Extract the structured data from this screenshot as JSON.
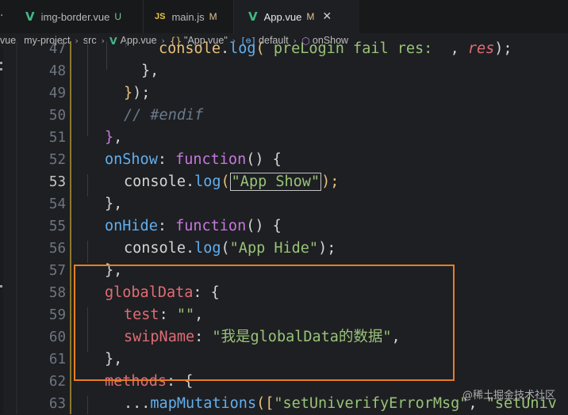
{
  "tabs": [
    {
      "label": "img-border.vue",
      "status": "U",
      "icon": "vue-icon",
      "active": false
    },
    {
      "label": "main.js",
      "status": "M",
      "icon": "js-icon",
      "active": false
    },
    {
      "label": "App.vue",
      "status": "M",
      "icon": "vue-icon",
      "active": true
    }
  ],
  "tab_overflow": "·",
  "close_glyph": "✕",
  "breadcrumb": {
    "cut": "vue",
    "project": "my-project",
    "folder": "src",
    "file": "App.vue",
    "object": "\"App.vue\"",
    "export": "default",
    "method": "onShow"
  },
  "editor": {
    "lines": [
      {
        "number": "47",
        "segments": [
          {
            "t": "    console.log( preLogin fail res:  , res);"
          }
        ]
      },
      {
        "number": "48",
        "segments": [
          {
            "t": "      },"
          }
        ]
      },
      {
        "number": "49",
        "segments": [
          {
            "t": "    });"
          }
        ]
      },
      {
        "number": "50",
        "segments": [
          {
            "t": "    // #endif"
          }
        ]
      },
      {
        "number": "51",
        "segments": [
          {
            "t": "  },"
          }
        ]
      },
      {
        "number": "52",
        "segments": [
          {
            "t": "  onShow: function() {"
          }
        ]
      },
      {
        "number": "53",
        "segments": [
          {
            "t": "    console.log(\"App Show\");"
          }
        ]
      },
      {
        "number": "54",
        "segments": [
          {
            "t": "  },"
          }
        ]
      },
      {
        "number": "55",
        "segments": [
          {
            "t": "  onHide: function() {"
          }
        ]
      },
      {
        "number": "56",
        "segments": [
          {
            "t": "    console.log(\"App Hide\");"
          }
        ]
      },
      {
        "number": "57",
        "segments": [
          {
            "t": "  },"
          }
        ]
      },
      {
        "number": "58",
        "segments": [
          {
            "t": "  globalData: {"
          }
        ]
      },
      {
        "number": "59",
        "segments": [
          {
            "t": "    test: \"\","
          }
        ]
      },
      {
        "number": "60",
        "segments": [
          {
            "t": "    swipName: \"我是globalData的数据\","
          }
        ]
      },
      {
        "number": "61",
        "segments": [
          {
            "t": "  },"
          }
        ]
      },
      {
        "number": "62",
        "segments": [
          {
            "t": "  methods: {"
          }
        ]
      },
      {
        "number": "63",
        "segments": [
          {
            "t": "    ...mapMutations([\"setUniverifyErrorMsg\", \"setUniv"
          }
        ]
      }
    ],
    "active_line": "53"
  },
  "code_tokens": {
    "l47": [
      "console",
      ".",
      "log",
      "( ",
      "preLogin fail res:",
      "  , ",
      "res",
      ");"
    ],
    "l50": "// #endif",
    "l52": [
      "onShow",
      ": ",
      "function",
      "() {"
    ],
    "l53": [
      "console",
      ".",
      "log",
      "(",
      "\"App Show\"",
      ");"
    ],
    "l55": [
      "onHide",
      ": ",
      "function",
      "() {"
    ],
    "l56": [
      "console",
      ".",
      "log",
      "(",
      "\"App Hide\"",
      ");"
    ],
    "l58": [
      "globalData",
      ": {"
    ],
    "l59": [
      "test",
      ": ",
      "\"\"",
      ","
    ],
    "l60": [
      "swipName",
      ": ",
      "\"我是globalData的数据\"",
      ","
    ],
    "l62": [
      "methods",
      ": {"
    ],
    "l63": [
      "...",
      "mapMutations",
      "([",
      "\"setUniverifyErrorMsg\"",
      ", ",
      "\"setUniv"
    ]
  },
  "colors": {
    "accent_box": "#e67e22",
    "vue_green": "#41b883",
    "background": "#1e1f22"
  },
  "watermark": "@稀土掘金技术社区"
}
